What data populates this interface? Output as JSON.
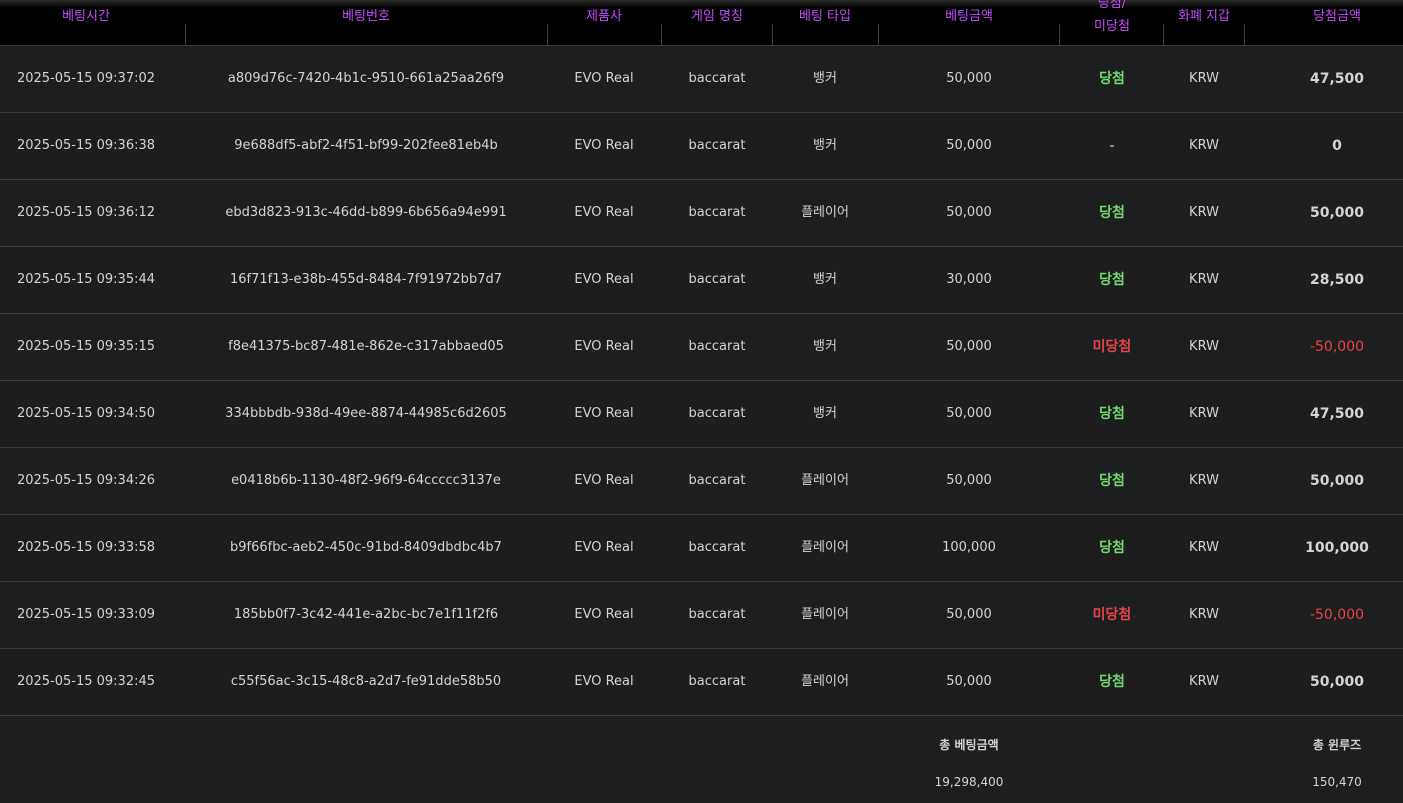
{
  "headers": {
    "bet_time": "베팅시간",
    "bet_number": "베팅번호",
    "provider": "제품사",
    "game_name": "게임 명칭",
    "bet_type": "베팅 타입",
    "bet_amount": "베팅금액",
    "result_line1": "당첨/",
    "result_line2": "미당첨",
    "currency_wallet": "화폐 지갑",
    "win_amount": "당첨금액"
  },
  "colors": {
    "header_text": "#c34dff",
    "win": "#73d96f",
    "lose": "#e8434b"
  },
  "rows": [
    {
      "time": "2025-05-15 09:37:02",
      "id": "a809d76c-7420-4b1c-9510-661a25aa26f9",
      "provider": "EVO Real",
      "game": "baccarat",
      "type": "뱅커",
      "bet": "50,000",
      "result": "당첨",
      "result_state": "win",
      "currency": "KRW",
      "win_amount": "47,500",
      "win_state": "pos"
    },
    {
      "time": "2025-05-15 09:36:38",
      "id": "9e688df5-abf2-4f51-bf99-202fee81eb4b",
      "provider": "EVO Real",
      "game": "baccarat",
      "type": "뱅커",
      "bet": "50,000",
      "result": "-",
      "result_state": "none",
      "currency": "KRW",
      "win_amount": "0",
      "win_state": "pos"
    },
    {
      "time": "2025-05-15 09:36:12",
      "id": "ebd3d823-913c-46dd-b899-6b656a94e991",
      "provider": "EVO Real",
      "game": "baccarat",
      "type": "플레이어",
      "bet": "50,000",
      "result": "당첨",
      "result_state": "win",
      "currency": "KRW",
      "win_amount": "50,000",
      "win_state": "pos"
    },
    {
      "time": "2025-05-15 09:35:44",
      "id": "16f71f13-e38b-455d-8484-7f91972bb7d7",
      "provider": "EVO Real",
      "game": "baccarat",
      "type": "뱅커",
      "bet": "30,000",
      "result": "당첨",
      "result_state": "win",
      "currency": "KRW",
      "win_amount": "28,500",
      "win_state": "pos"
    },
    {
      "time": "2025-05-15 09:35:15",
      "id": "f8e41375-bc87-481e-862e-c317abbaed05",
      "provider": "EVO Real",
      "game": "baccarat",
      "type": "뱅커",
      "bet": "50,000",
      "result": "미당첨",
      "result_state": "lose",
      "currency": "KRW",
      "win_amount": "-50,000",
      "win_state": "neg"
    },
    {
      "time": "2025-05-15 09:34:50",
      "id": "334bbbdb-938d-49ee-8874-44985c6d2605",
      "provider": "EVO Real",
      "game": "baccarat",
      "type": "뱅커",
      "bet": "50,000",
      "result": "당첨",
      "result_state": "win",
      "currency": "KRW",
      "win_amount": "47,500",
      "win_state": "pos"
    },
    {
      "time": "2025-05-15 09:34:26",
      "id": "e0418b6b-1130-48f2-96f9-64ccccc3137e",
      "provider": "EVO Real",
      "game": "baccarat",
      "type": "플레이어",
      "bet": "50,000",
      "result": "당첨",
      "result_state": "win",
      "currency": "KRW",
      "win_amount": "50,000",
      "win_state": "pos"
    },
    {
      "time": "2025-05-15 09:33:58",
      "id": "b9f66fbc-aeb2-450c-91bd-8409dbdbc4b7",
      "provider": "EVO Real",
      "game": "baccarat",
      "type": "플레이어",
      "bet": "100,000",
      "result": "당첨",
      "result_state": "win",
      "currency": "KRW",
      "win_amount": "100,000",
      "win_state": "pos"
    },
    {
      "time": "2025-05-15 09:33:09",
      "id": "185bb0f7-3c42-441e-a2bc-bc7e1f11f2f6",
      "provider": "EVO Real",
      "game": "baccarat",
      "type": "플레이어",
      "bet": "50,000",
      "result": "미당첨",
      "result_state": "lose",
      "currency": "KRW",
      "win_amount": "-50,000",
      "win_state": "neg"
    },
    {
      "time": "2025-05-15 09:32:45",
      "id": "c55f56ac-3c15-48c8-a2d7-fe91dde58b50",
      "provider": "EVO Real",
      "game": "baccarat",
      "type": "플레이어",
      "bet": "50,000",
      "result": "당첨",
      "result_state": "win",
      "currency": "KRW",
      "win_amount": "50,000",
      "win_state": "pos"
    }
  ],
  "footer": {
    "total_bet_label": "총 베팅금액",
    "total_bet_value": "19,298,400",
    "total_winloss_label": "총 윈루즈",
    "total_winloss_value": "150,470"
  }
}
